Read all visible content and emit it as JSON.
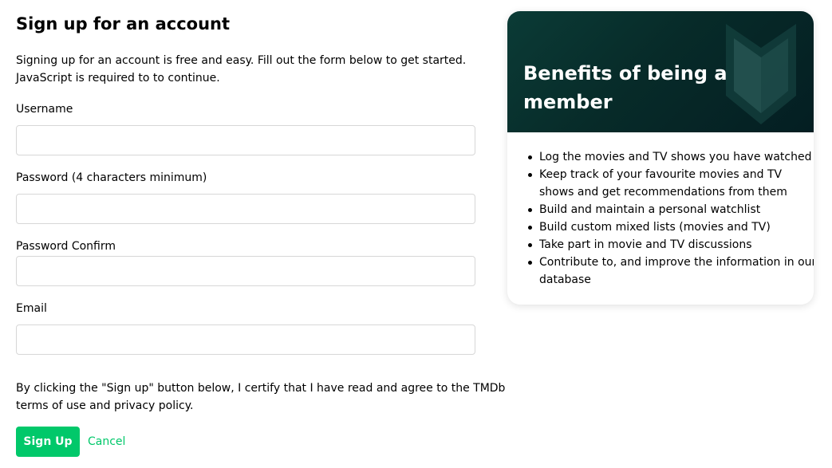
{
  "form": {
    "title": "Sign up for an account",
    "intro_line1": "Signing up for an account is free and easy. Fill out the form below to get started.",
    "intro_line2": "JavaScript is required to to continue.",
    "fields": [
      {
        "label": "Username",
        "value": "",
        "placeholder": ""
      },
      {
        "label": "Password (4 characters minimum)",
        "value": "",
        "placeholder": ""
      },
      {
        "label": "Password Confirm",
        "value": "",
        "placeholder": ""
      },
      {
        "label": "Email",
        "value": "",
        "placeholder": ""
      }
    ],
    "terms_line1": "By clicking the \"Sign up\" button below, I certify that I have read and agree to the TMDb",
    "terms_line2": "terms of use and privacy policy.",
    "signup_label": "Sign Up",
    "cancel_label": "Cancel"
  },
  "benefits": {
    "title": "Benefits of being a member",
    "header_icon": "tmdb-shield-icon",
    "items": [
      "Log the movies and TV shows you have watched",
      "Keep track of your favourite movies and TV shows and get recommendations from them",
      "Build and maintain a personal watchlist",
      "Build custom mixed lists (movies and TV)",
      "Take part in movie and TV discussions",
      "Contribute to, and improve the information in our database"
    ]
  },
  "colors": {
    "accent": "#01c86a",
    "card_header_dark": "#041e22",
    "card_header_teal": "#0b3b36",
    "input_border": "#d7d7d7"
  }
}
